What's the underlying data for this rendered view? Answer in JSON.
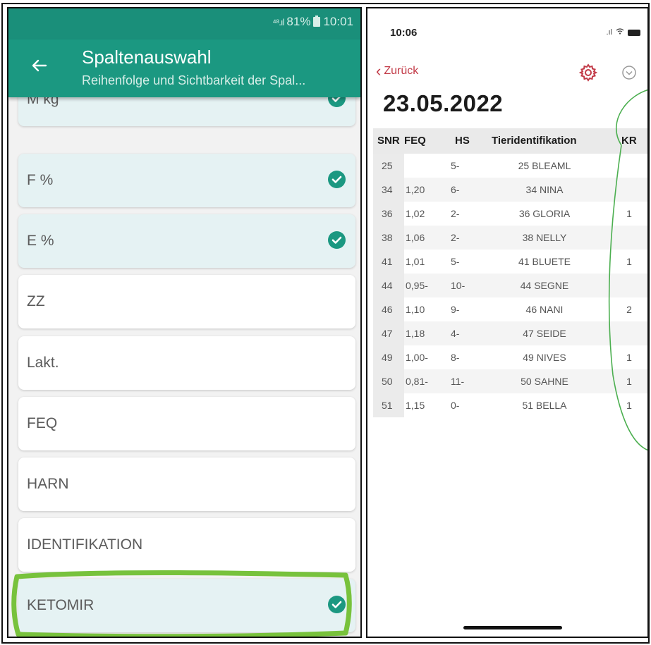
{
  "left": {
    "status_text": "81%",
    "status_time": "10:01",
    "appbar": {
      "title": "Spaltenauswahl",
      "subtitle": "Reihenfolge und Sichtbarkeit der Spal..."
    },
    "columns": [
      {
        "label": "M kg",
        "checked": true
      },
      {
        "label": "F %",
        "checked": true
      },
      {
        "label": "E %",
        "checked": true
      },
      {
        "label": "ZZ",
        "checked": false
      },
      {
        "label": "Lakt.",
        "checked": false
      },
      {
        "label": "FEQ",
        "checked": false
      },
      {
        "label": "HARN",
        "checked": false
      },
      {
        "label": "IDENTIFIKATION",
        "checked": false
      },
      {
        "label": "KETOMIR",
        "checked": true
      }
    ],
    "accent_color": "#1b9881"
  },
  "right": {
    "status_time": "10:06",
    "nav": {
      "back_label": "Zurück"
    },
    "date_title": "23.05.2022",
    "table": {
      "headers": [
        "SNR",
        "FEQ",
        "HS",
        "Tieridentifikation",
        "KR"
      ],
      "rows": [
        [
          "25",
          "",
          "5-",
          "25 BLEAML",
          ""
        ],
        [
          "34",
          "1,20",
          "6-",
          "34 NINA",
          ""
        ],
        [
          "36",
          "1,02",
          "2-",
          "36 GLORIA",
          "1"
        ],
        [
          "38",
          "1,06",
          "2-",
          "38 NELLY",
          ""
        ],
        [
          "41",
          "1,01",
          "5-",
          "41 BLUETE",
          "1"
        ],
        [
          "44",
          "0,95-",
          "10-",
          "44 SEGNE",
          ""
        ],
        [
          "46",
          "1,10",
          "9-",
          "46 NANI",
          "2"
        ],
        [
          "47",
          "1,18",
          "4-",
          "47 SEIDE",
          ""
        ],
        [
          "49",
          "1,00-",
          "8-",
          "49 NIVES",
          "1"
        ],
        [
          "50",
          "0,81-",
          "11-",
          "50 SAHNE",
          "1"
        ],
        [
          "51",
          "1,15",
          "0-",
          "51 BELLA",
          "1"
        ]
      ]
    },
    "accent_color": "#c23a47"
  }
}
